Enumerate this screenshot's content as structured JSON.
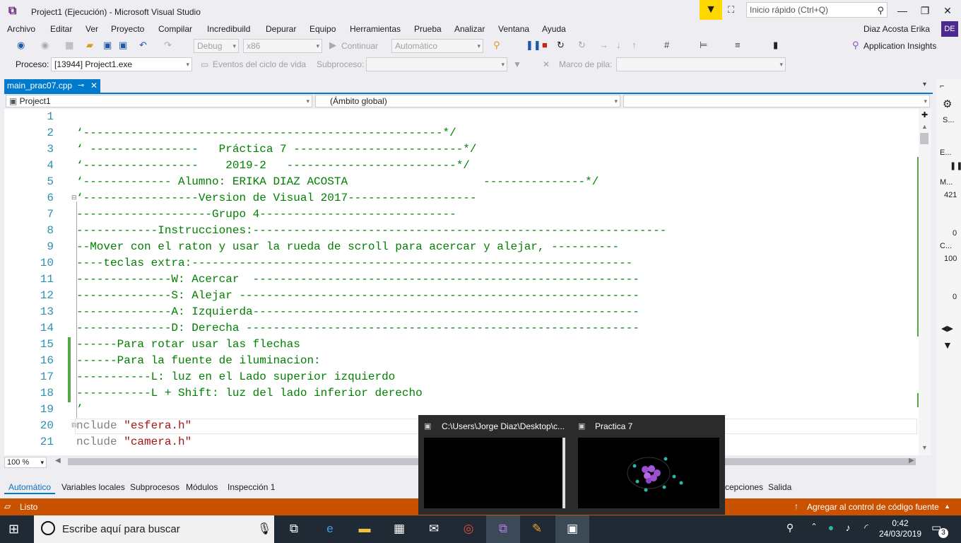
{
  "window": {
    "title": "Project1 (Ejecución) - Microsoft Visual Studio",
    "quick_launch_placeholder": "Inicio rápido (Ctrl+Q)"
  },
  "menu": [
    "Archivo",
    "Editar",
    "Ver",
    "Proyecto",
    "Compilar",
    "Incredibuild",
    "Depurar",
    "Equipo",
    "Herramientas",
    "Prueba",
    "Analizar",
    "Ventana",
    "Ayuda"
  ],
  "user": {
    "name": "Diaz Acosta Erika",
    "initials": "DE"
  },
  "toolbar": {
    "config": "Debug",
    "platform": "x86",
    "continue_label": "Continuar",
    "auto_label": "Automático",
    "app_insights": "Application Insights"
  },
  "process_bar": {
    "process_label": "Proceso:",
    "process_value": "[13944] Project1.exe",
    "events_label": "Eventos del ciclo de vida",
    "subprocess_label": "Subproceso:",
    "stack_label": "Marco de pila:"
  },
  "tab": {
    "file": "main_prac07.cpp"
  },
  "navbar": {
    "project": "Project1",
    "scope": "(Ámbito global)"
  },
  "code_lines": [
    {
      "n": "1",
      "text": ""
    },
    {
      "n": "2",
      "text": "‘-----------------------------------------------------*/"
    },
    {
      "n": "3",
      "text": "‘ ----------------   Práctica 7 -------------------------*/"
    },
    {
      "n": "4",
      "text": "‘-----------------    2019-2   -------------------------*/"
    },
    {
      "n": "5",
      "text": "‘------------- Alumno: ERIKA DIAZ ACOSTA                    ---------------*/"
    },
    {
      "n": "6",
      "text": "‘-----------------Version de Visual 2017-------------------"
    },
    {
      "n": "7",
      "text": "--------------------Grupo 4-----------------------------"
    },
    {
      "n": "8",
      "text": "------------Instrucciones:-------------------------------------------------------------"
    },
    {
      "n": "9",
      "text": "--Mover con el raton y usar la rueda de scroll para acercar y alejar, ----------"
    },
    {
      "n": "10",
      "text": "----teclas extra:-----------------------------------------------------------------"
    },
    {
      "n": "11",
      "text": "--------------W: Acercar  ---------------------------------------------------------"
    },
    {
      "n": "12",
      "text": "--------------S: Alejar -----------------------------------------------------------"
    },
    {
      "n": "13",
      "text": "--------------A: Izquierda---------------------------------------------------------"
    },
    {
      "n": "14",
      "text": "--------------D: Derecha ----------------------------------------------------------"
    },
    {
      "n": "15",
      "text": "------Para rotar usar las flechas"
    },
    {
      "n": "16",
      "text": "------Para la fuente de iluminacion:"
    },
    {
      "n": "17",
      "text": "-----------L: luz en el Lado superior izquierdo"
    },
    {
      "n": "18",
      "text": "-----------L + Shift: luz del lado inferior derecho"
    },
    {
      "n": "19",
      "text": "’"
    }
  ],
  "include_lines": [
    {
      "n": "20",
      "pp": "nclude ",
      "str": "\"esfera.h\""
    },
    {
      "n": "21",
      "pp": "nclude ",
      "str": "\"camera.h\""
    }
  ],
  "zoom": "100 %",
  "bottom_tabs": [
    "Automático",
    "Variables locales",
    "Subprocesos",
    "Módulos",
    "Inspección 1"
  ],
  "bottom_tabs_right": [
    "cepciones",
    "Salida"
  ],
  "status": {
    "text": "Listo",
    "source_control": "Agregar al control de código fuente"
  },
  "taskbar": {
    "search_placeholder": "Escribe aquí para buscar",
    "time": "0:42",
    "date": "24/03/2019",
    "notification_count": "3"
  },
  "thumbnails": [
    {
      "title": "C:\\Users\\Jorge Diaz\\Desktop\\c..."
    },
    {
      "title": "Practica 7"
    }
  ],
  "right_panel": {
    "items": [
      "S...",
      "E...",
      "M...",
      "421",
      "0",
      "C...",
      "100",
      "0"
    ]
  },
  "colors": {
    "accent": "#007acc",
    "status": "#ca5100",
    "comment": "#008000",
    "string": "#a31515",
    "line_number": "#2b91af"
  }
}
